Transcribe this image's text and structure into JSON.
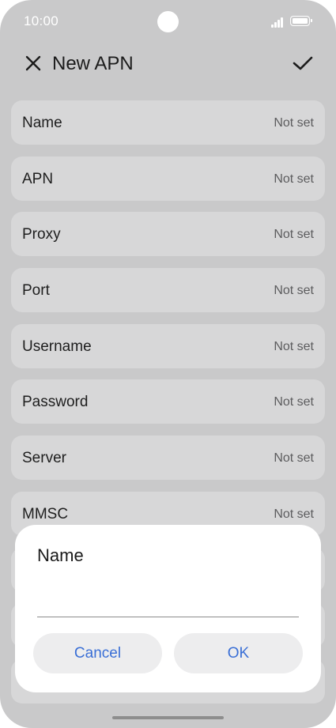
{
  "status_bar": {
    "time": "10:00"
  },
  "header": {
    "title": "New APN"
  },
  "fields": [
    {
      "label": "Name",
      "value": "Not set"
    },
    {
      "label": "APN",
      "value": "Not set"
    },
    {
      "label": "Proxy",
      "value": "Not set"
    },
    {
      "label": "Port",
      "value": "Not set"
    },
    {
      "label": "Username",
      "value": "Not set"
    },
    {
      "label": "Password",
      "value": "Not set"
    },
    {
      "label": "Server",
      "value": "Not set"
    },
    {
      "label": "MMSC",
      "value": "Not set"
    }
  ],
  "dialog": {
    "title": "Name",
    "input_value": "",
    "cancel_label": "Cancel",
    "ok_label": "OK"
  },
  "colors": {
    "background": "#c9c9ca",
    "row": "#d7d7d8",
    "accent": "#3a6fd6",
    "dialog": "#ffffff"
  },
  "icons": [
    "close-icon",
    "check-icon",
    "signal-icon",
    "battery-icon"
  ]
}
